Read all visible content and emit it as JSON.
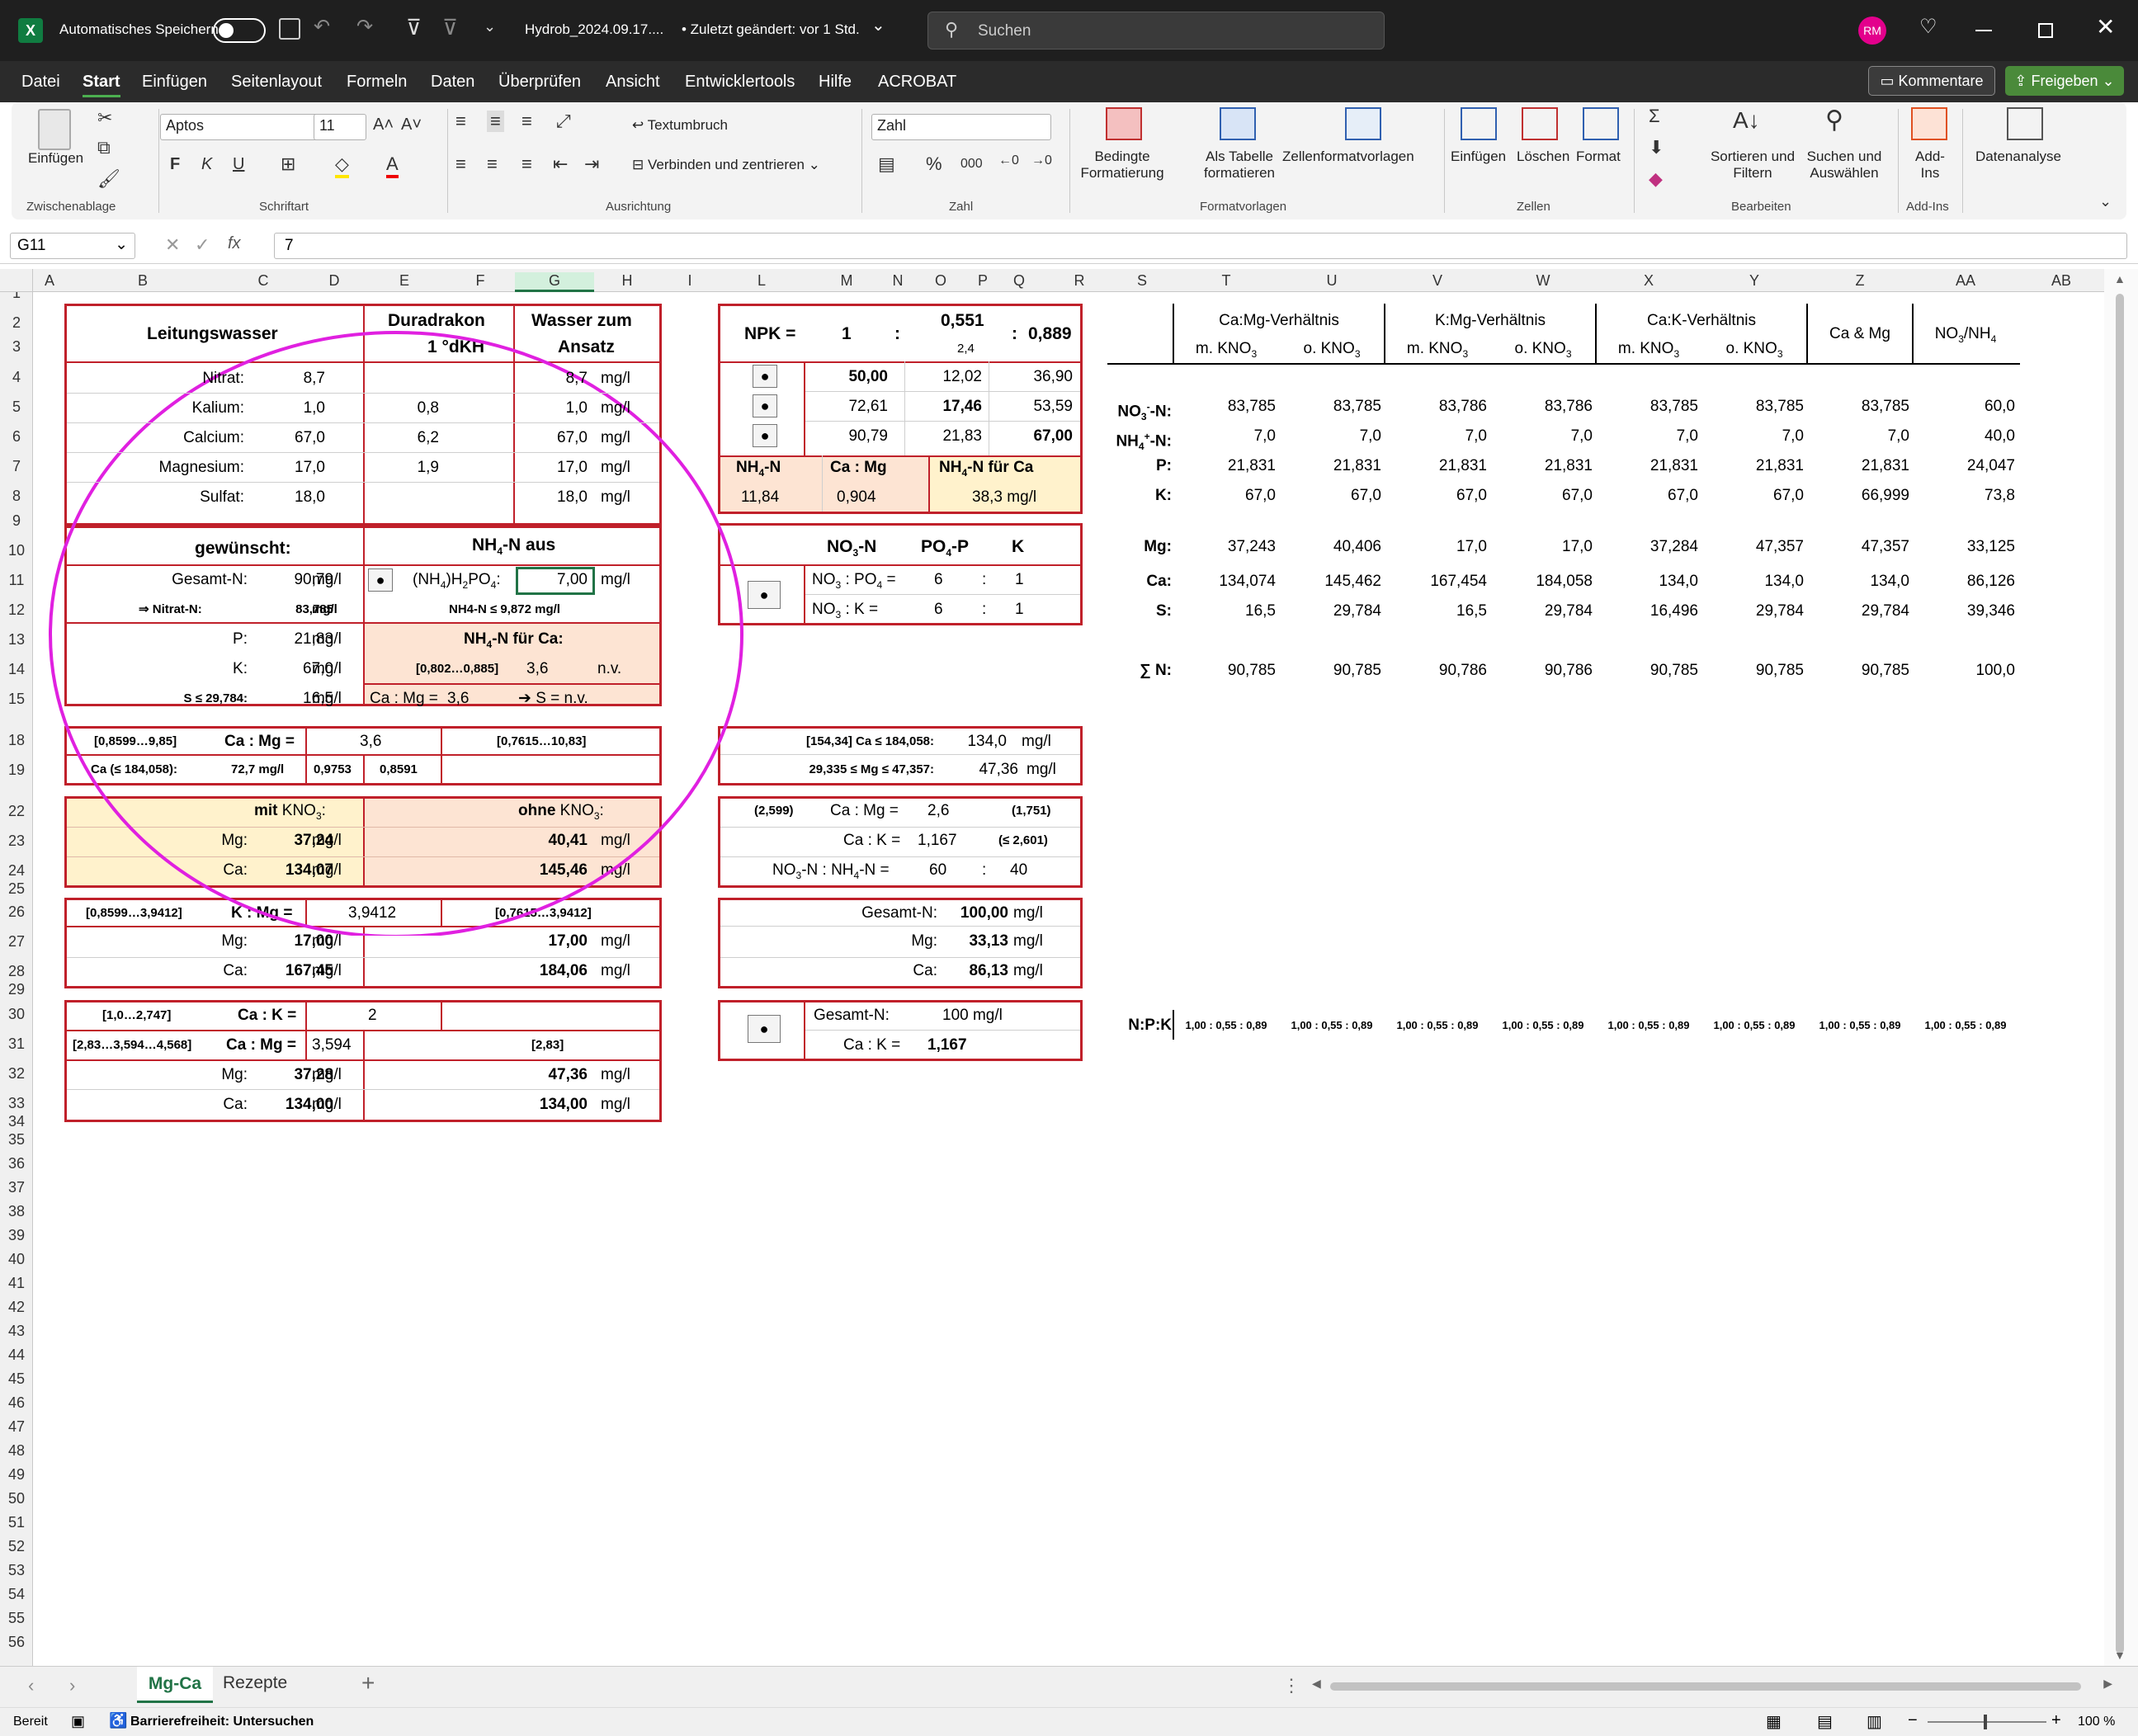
{
  "title_bar": {
    "autosave_label": "Automatisches Speichern",
    "file_name": "Hydrob_2024.09.17....",
    "status": "• Zuletzt geändert: vor 1 Std.",
    "search_placeholder": "Suchen",
    "avatar_initials": "RM"
  },
  "menu": {
    "items": [
      "Datei",
      "Start",
      "Einfügen",
      "Seitenlayout",
      "Formeln",
      "Daten",
      "Überprüfen",
      "Ansicht",
      "Entwicklertools",
      "Hilfe",
      "ACROBAT"
    ],
    "comments_label": "Kommentare",
    "share_label": "Freigeben"
  },
  "ribbon": {
    "paste_label": "Einfügen",
    "font_name": "Aptos",
    "font_size": "11",
    "bold": "F",
    "italic": "K",
    "underline": "U",
    "wrap_text": "Textumbruch",
    "merge_center": "Verbinden und zentrieren",
    "number_format": "Zahl",
    "cond_format": "Bedingte Formatierung",
    "as_table": "Als Tabelle formatieren",
    "cell_styles": "Zellenformatvorlagen",
    "insert": "Einfügen",
    "delete": "Löschen",
    "format": "Format",
    "sort_filter": "Sortieren und Filtern",
    "find_select": "Suchen und Auswählen",
    "addins": "Add-Ins",
    "data_analysis": "Datenanalyse",
    "groups": {
      "clipboard": "Zwischenablage",
      "font": "Schriftart",
      "alignment": "Ausrichtung",
      "number": "Zahl",
      "styles": "Formatvorlagen",
      "cells": "Zellen",
      "editing": "Bearbeiten",
      "addins": "Add-Ins"
    }
  },
  "formula_bar": {
    "name_box": "G11",
    "formula": "7"
  },
  "columns": [
    "A",
    "B",
    "C",
    "D",
    "E",
    "F",
    "G",
    "H",
    "I",
    "L",
    "M",
    "N",
    "O",
    "P",
    "Q",
    "R",
    "S",
    "T",
    "U",
    "V",
    "W",
    "X",
    "Y",
    "Z",
    "AA",
    "AB"
  ],
  "rows": [
    "1",
    "2",
    "3",
    "4",
    "5",
    "6",
    "7",
    "8",
    "9",
    "10",
    "11",
    "12",
    "13",
    "14",
    "15",
    "18",
    "19",
    "22",
    "23",
    "24",
    "25",
    "26",
    "27",
    "28",
    "29",
    "30",
    "31",
    "32",
    "33",
    "34",
    "35",
    "36",
    "37",
    "38",
    "39",
    "40",
    "41",
    "42",
    "43",
    "44",
    "45",
    "46",
    "47",
    "48",
    "49",
    "50",
    "51",
    "52",
    "53",
    "54",
    "55",
    "56"
  ],
  "sheet_tabs": [
    "Mg-Ca",
    "Rezepte"
  ],
  "status": {
    "ready": "Bereit",
    "accessibility": "Barrierefreiheit: Untersuchen",
    "zoom": "100 %"
  },
  "cells": {
    "t1": {
      "h_water": "Leitungswasser",
      "h_dura": "Duradrakon",
      "h_dura2": "1   °dKH",
      "h_ansatz": "Wasser zum",
      "h_ansatz2": "Ansatz",
      "rows": [
        [
          "Nitrat:",
          "8,7",
          "",
          "8,7",
          "mg/l"
        ],
        [
          "Kalium:",
          "1,0",
          "0,8",
          "1,0",
          "mg/l"
        ],
        [
          "Calcium:",
          "67,0",
          "6,2",
          "67,0",
          "mg/l"
        ],
        [
          "Magnesium:",
          "17,0",
          "1,9",
          "17,0",
          "mg/l"
        ],
        [
          "Sulfat:",
          "18,0",
          "",
          "18,0",
          "mg/l"
        ]
      ]
    },
    "t2": {
      "h_wish": "gewünscht:",
      "h_nh4": "NH4-N aus",
      "gesamt_label": "Gesamt-N:",
      "gesamt_val": "90,79",
      "unit": "mg/l",
      "nh4_src": "(NH4)H2PO4:",
      "nh4_val": "7,00",
      "nitrat_label": "⇒ Nitrat-N:",
      "nitrat_val": "83,785",
      "nh4_max": "NH4-N ≤ 9,872 mg/l",
      "p_label": "P:",
      "p_val": "21,83",
      "nh4_ca": "NH4-N für Ca:",
      "k_label": "K:",
      "k_val": "67,0",
      "range1": "[0,802…0,885]",
      "range1_val": "3,6",
      "nv": "n.v.",
      "s_label": "S ≤ 29,784:",
      "s_val": "16,5",
      "camg_label": "Ca : Mg =",
      "camg_val": "3,6",
      "s_arrow": "➔ S = n.v."
    },
    "t3": {
      "r1_range": "[0,8599…9,85]",
      "r1_label": "Ca : Mg =",
      "r1_val": "3,6",
      "r1_range2": "[0,7615…10,83]",
      "r2_label": "Ca (≤ 184,058):",
      "r2_val": "72,7 mg/l",
      "r2_a": "0,9753",
      "r2_b": "0,8591"
    },
    "t4": {
      "mit": "mit KNO3:",
      "ohne": "ohne KNO3:",
      "mg_label": "Mg:",
      "mg_mit": "37,24",
      "mg_ohne": "40,41",
      "ca_label": "Ca:",
      "ca_mit": "134,07",
      "ca_ohne": "145,46",
      "unit": "mg/l"
    },
    "t5": {
      "range": "[0,8599…3,9412]",
      "label": "K : Mg =",
      "val": "3,9412",
      "range2": "[0,7615…3,9412]",
      "mg_label": "Mg:",
      "mg_a": "17,00",
      "mg_b": "17,00",
      "ca_label": "Ca:",
      "ca_a": "167,45",
      "ca_b": "184,06",
      "unit": "mg/l"
    },
    "t6": {
      "range1": "[1,0…2,747]",
      "label1": "Ca : K =",
      "val1": "2",
      "range2": "[2,83…3,594…4,568]",
      "label2": "Ca : Mg =",
      "val2": "3,594",
      "range3": "[2,83]",
      "mg_label": "Mg:",
      "mg_a": "37,28",
      "mg_b": "47,36",
      "ca_label": "Ca:",
      "ca_a": "134,00",
      "ca_b": "134,00",
      "unit": "mg/l"
    },
    "n1": {
      "npk": "NPK =",
      "one": "1",
      "colon": ":",
      "p": "0,551",
      "p_sub": "2,4",
      "k": "0,889",
      "rows": [
        [
          "50,00",
          "12,02",
          "36,90"
        ],
        [
          "72,61",
          "17,46",
          "53,59"
        ],
        [
          "90,79",
          "21,83",
          "67,00"
        ]
      ],
      "h_nh4": "NH4-N",
      "h_camg": "Ca : Mg",
      "h_nh4ca": "NH4-N für Ca",
      "v_nh4": "11,84",
      "v_camg": "0,904",
      "v_nh4ca": "38,3 mg/l"
    },
    "n2": {
      "h1": "NO3-N",
      "h2": "PO4-P",
      "h3": "K",
      "r1_label": "NO3 : PO4 =",
      "r1_a": "6",
      "r1_b": "1",
      "r2_label": "NO3 : K =",
      "r2_a": "6",
      "r2_b": "1"
    },
    "n3": {
      "r1_label": "[154,34] Ca ≤ 184,058:",
      "r1_val": "134,0",
      "r2_label": "29,335 ≤ Mg ≤ 47,357:",
      "r2_val": "47,36",
      "unit": "mg/l"
    },
    "n4": {
      "r1_a": "(2,599)",
      "r1_label": "Ca : Mg =",
      "r1_val": "2,6",
      "r1_b": "(1,751)",
      "r2_label": "Ca : K =",
      "r2_val": "1,167",
      "r2_b": "(≤ 2,601)",
      "r3_label": "NO3-N : NH4-N =",
      "r3_a": "60",
      "r3_b": "40"
    },
    "n5": {
      "g_label": "Gesamt-N:",
      "g_val": "100,00",
      "mg_label": "Mg:",
      "mg_val": "33,13",
      "ca_label": "Ca:",
      "ca_val": "86,13",
      "unit": "mg/l"
    },
    "n6": {
      "g_label": "Gesamt-N:",
      "g_val": "100 mg/l",
      "k_label": "Ca : K =",
      "k_val": "1,167"
    },
    "right": {
      "groups": [
        "Ca:Mg-Verhältnis",
        "K:Mg-Verhältnis",
        "Ca:K-Verhältnis",
        "Ca & Mg",
        "NO3/NH4"
      ],
      "subs": [
        "m. KNO3",
        "o. KNO3",
        "m. KNO3",
        "o. KNO3",
        "m. KNO3",
        "o. KNO3"
      ],
      "rows": [
        {
          "label": "NO3-N:",
          "vals": [
            "83,785",
            "83,785",
            "83,786",
            "83,786",
            "83,785",
            "83,785",
            "83,785",
            "60,0"
          ]
        },
        {
          "label": "NH4+-N:",
          "vals": [
            "7,0",
            "7,0",
            "7,0",
            "7,0",
            "7,0",
            "7,0",
            "7,0",
            "40,0"
          ]
        },
        {
          "label": "P:",
          "vals": [
            "21,831",
            "21,831",
            "21,831",
            "21,831",
            "21,831",
            "21,831",
            "21,831",
            "24,047"
          ]
        },
        {
          "label": "K:",
          "vals": [
            "67,0",
            "67,0",
            "67,0",
            "67,0",
            "67,0",
            "67,0",
            "66,999",
            "73,8"
          ]
        },
        {
          "label": "Mg:",
          "vals": [
            "37,243",
            "40,406",
            "17,0",
            "17,0",
            "37,284",
            "47,357",
            "47,357",
            "33,125"
          ]
        },
        {
          "label": "Ca:",
          "vals": [
            "134,074",
            "145,462",
            "167,454",
            "184,058",
            "134,0",
            "134,0",
            "134,0",
            "86,126"
          ]
        },
        {
          "label": "S:",
          "vals": [
            "16,5",
            "29,784",
            "16,5",
            "29,784",
            "16,496",
            "29,784",
            "29,784",
            "39,346"
          ]
        },
        {
          "label": "∑ N:",
          "vals": [
            "90,785",
            "90,785",
            "90,786",
            "90,786",
            "90,785",
            "90,785",
            "90,785",
            "100,0"
          ]
        },
        {
          "label": "N:P:K",
          "vals": [
            "1,00 : 0,55 : 0,89",
            "1,00 : 0,55 : 0,89",
            "1,00 : 0,55 : 0,89",
            "1,00 : 0,55 : 0,89",
            "1,00 : 0,55 : 0,89",
            "1,00 : 0,55 : 0,89",
            "1,00 : 0,55 : 0,89",
            "1,00 : 0,55 : 0,89"
          ]
        }
      ]
    }
  },
  "colors": {
    "accent": "#c0202a",
    "peach": "#fde4d3",
    "yellow": "#fff2cc",
    "circle": "#e020e0",
    "share": "#5cb85c"
  }
}
